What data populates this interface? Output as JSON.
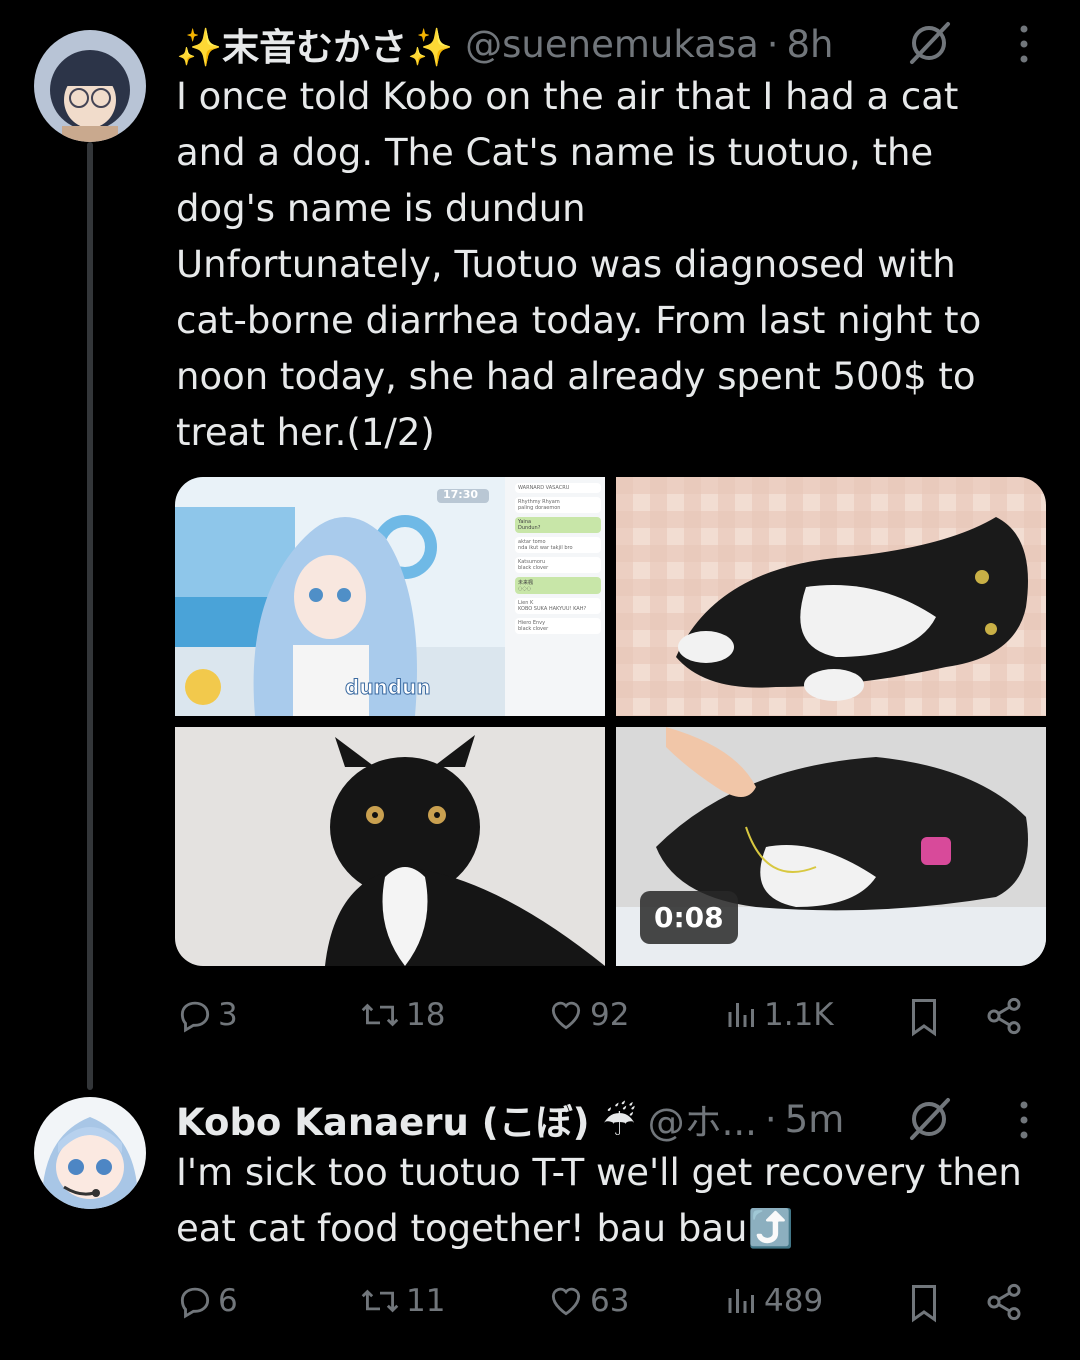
{
  "tweets": [
    {
      "display_name": "✨末音むかさ✨",
      "handle": "@suenemukasa",
      "dot": "·",
      "time": "8h",
      "text_lines": [
        "I once told Kobo on the air that I had a cat",
        "and a dog. The Cat's name is tuotuo, the",
        "dog's name is dundun",
        "Unfortunately, Tuotuo was diagnosed with",
        "cat-borne diarrhea today. From last night to",
        "noon today, she had already spent 500$ to",
        "treat her.(1/2)"
      ],
      "media": {
        "stream": {
          "clock": "17:30",
          "caption": "dundun",
          "chat": [
            {
              "user": "WARNARD VASACRU",
              "msg": ""
            },
            {
              "user": "Rhythmy Rhyam",
              "msg": "paling doraemon"
            },
            {
              "user": "Yaina",
              "msg": "Dundun?"
            },
            {
              "user": "aktar tomo",
              "msg": "nda ikut war takjil bro"
            },
            {
              "user": "Katsumoru",
              "msg": "black clover"
            },
            {
              "user": "未来楓",
              "msg": "◌◌◌"
            },
            {
              "user": "Lien K",
              "msg": "KOBO SUKA HAKYUU! KAH?"
            },
            {
              "user": "Hiero Envy",
              "msg": "black clover"
            }
          ]
        },
        "video_duration": "0:08"
      },
      "stats": {
        "replies": "3",
        "reposts": "18",
        "likes": "92",
        "views": "1.1K"
      }
    },
    {
      "display_name": "Kobo Kanaeru (こぼ) ☔",
      "handle": "@ホ...",
      "dot": "·",
      "time": "5m",
      "text_lines": [
        "I'm sick too tuotuo T-T we'll get recovery then",
        "eat cat food together! bau bau⤴️"
      ],
      "stats": {
        "replies": "6",
        "reposts": "11",
        "likes": "63",
        "views": "489"
      }
    }
  ],
  "colors": {
    "background": "#000000",
    "text": "#e7e9ea",
    "muted": "#71767b",
    "thread_line": "#333639"
  },
  "icons": [
    "reply-icon",
    "repost-icon",
    "like-icon",
    "views-icon",
    "bookmark-icon",
    "share-icon",
    "grok-icon",
    "more-icon"
  ]
}
